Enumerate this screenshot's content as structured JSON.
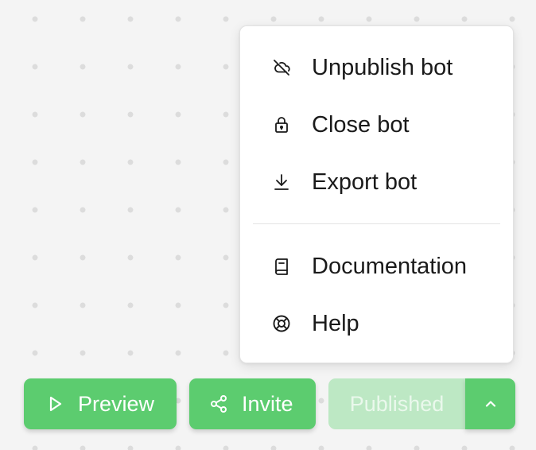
{
  "menu": {
    "items": [
      {
        "label": "Unpublish bot",
        "icon": "cloud-off-icon"
      },
      {
        "label": "Close bot",
        "icon": "lock-icon"
      },
      {
        "label": "Export bot",
        "icon": "download-icon"
      },
      {
        "label": "Documentation",
        "icon": "book-icon"
      },
      {
        "label": "Help",
        "icon": "life-buoy-icon"
      }
    ]
  },
  "toolbar": {
    "preview_label": "Preview",
    "invite_label": "Invite",
    "published_label": "Published"
  },
  "colors": {
    "accent": "#5ccc6f",
    "accent_disabled": "#bde8c4",
    "canvas": "#f4f4f4",
    "menu_bg": "#ffffff"
  }
}
